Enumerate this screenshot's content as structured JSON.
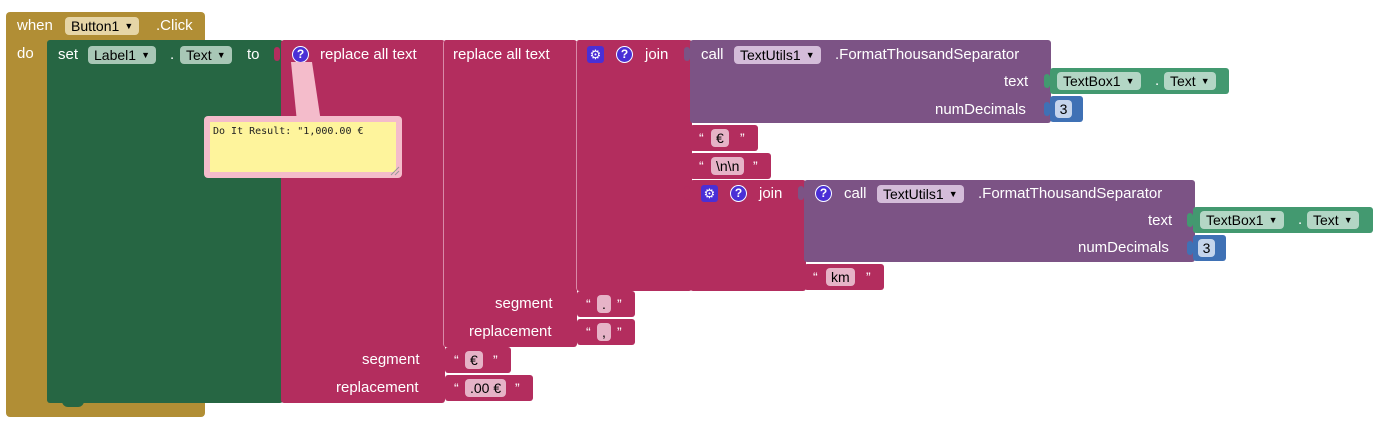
{
  "event": {
    "when_label": "when",
    "component": "Button1",
    "event_name": ".Click",
    "do_label": "do"
  },
  "setter": {
    "set_label": "set",
    "component": "Label1",
    "dot": ".",
    "property": "Text",
    "to_label": "to"
  },
  "replace_outer": {
    "label": "replace all text",
    "segment_label": "segment",
    "replacement_label": "replacement",
    "segment_value": "€",
    "replacement_value": ".00 €"
  },
  "replace_inner": {
    "label": "replace all text",
    "segment_label": "segment",
    "replacement_label": "replacement",
    "segment_value": ".",
    "replacement_value": ","
  },
  "join1": {
    "label": "join",
    "call": {
      "call_label": "call",
      "component": "TextUtils1",
      "method": ".FormatThousandSeparator",
      "text_label": "text",
      "text_component": "TextBox1",
      "text_dot": ".",
      "text_property": "Text",
      "numdec_label": "numDecimals",
      "numdec_value": "3"
    },
    "str1": "€",
    "str2": "\\n\\n"
  },
  "join2": {
    "label": "join",
    "call": {
      "call_label": "call",
      "component": "TextUtils1",
      "method": ".FormatThousandSeparator",
      "text_label": "text",
      "text_component": "TextBox1",
      "text_dot": ".",
      "text_property": "Text",
      "numdec_label": "numDecimals",
      "numdec_value": "3"
    },
    "str_km": "km"
  },
  "comment": {
    "text": "Do It Result: \"1,000.00 €"
  },
  "quotes": {
    "open": "“",
    "close": "”"
  },
  "icons": {
    "help": "?",
    "gear": "⚙",
    "arrow": "▼"
  },
  "colors": {
    "event": "#b18e35",
    "setter": "#266643",
    "text": "#b32d5e",
    "procedure": "#7c5385",
    "component": "#439970",
    "math": "#3f71b5",
    "comment": "#fef49c"
  }
}
